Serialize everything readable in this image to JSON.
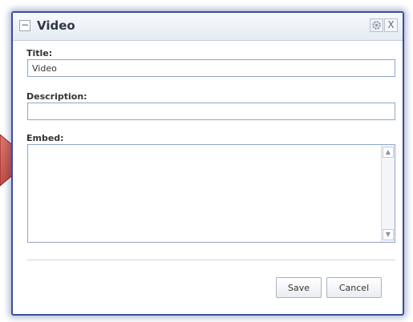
{
  "dialog": {
    "title": "Video",
    "collapse_symbol": "−",
    "close_symbol": "X",
    "icons": [
      "collapse-icon",
      "gear-icon",
      "close-icon",
      "scroll-up-icon",
      "scroll-down-icon"
    ]
  },
  "form": {
    "title_label": "Title:",
    "title_value": "Video",
    "description_label": "Description:",
    "description_value": "",
    "embed_label": "Embed:",
    "embed_value": ""
  },
  "buttons": {
    "save": "Save",
    "cancel": "Cancel"
  },
  "colors": {
    "dialog_border": "#3b4e9a",
    "input_border": "#8fa7c9",
    "arrow": "#b33434"
  }
}
